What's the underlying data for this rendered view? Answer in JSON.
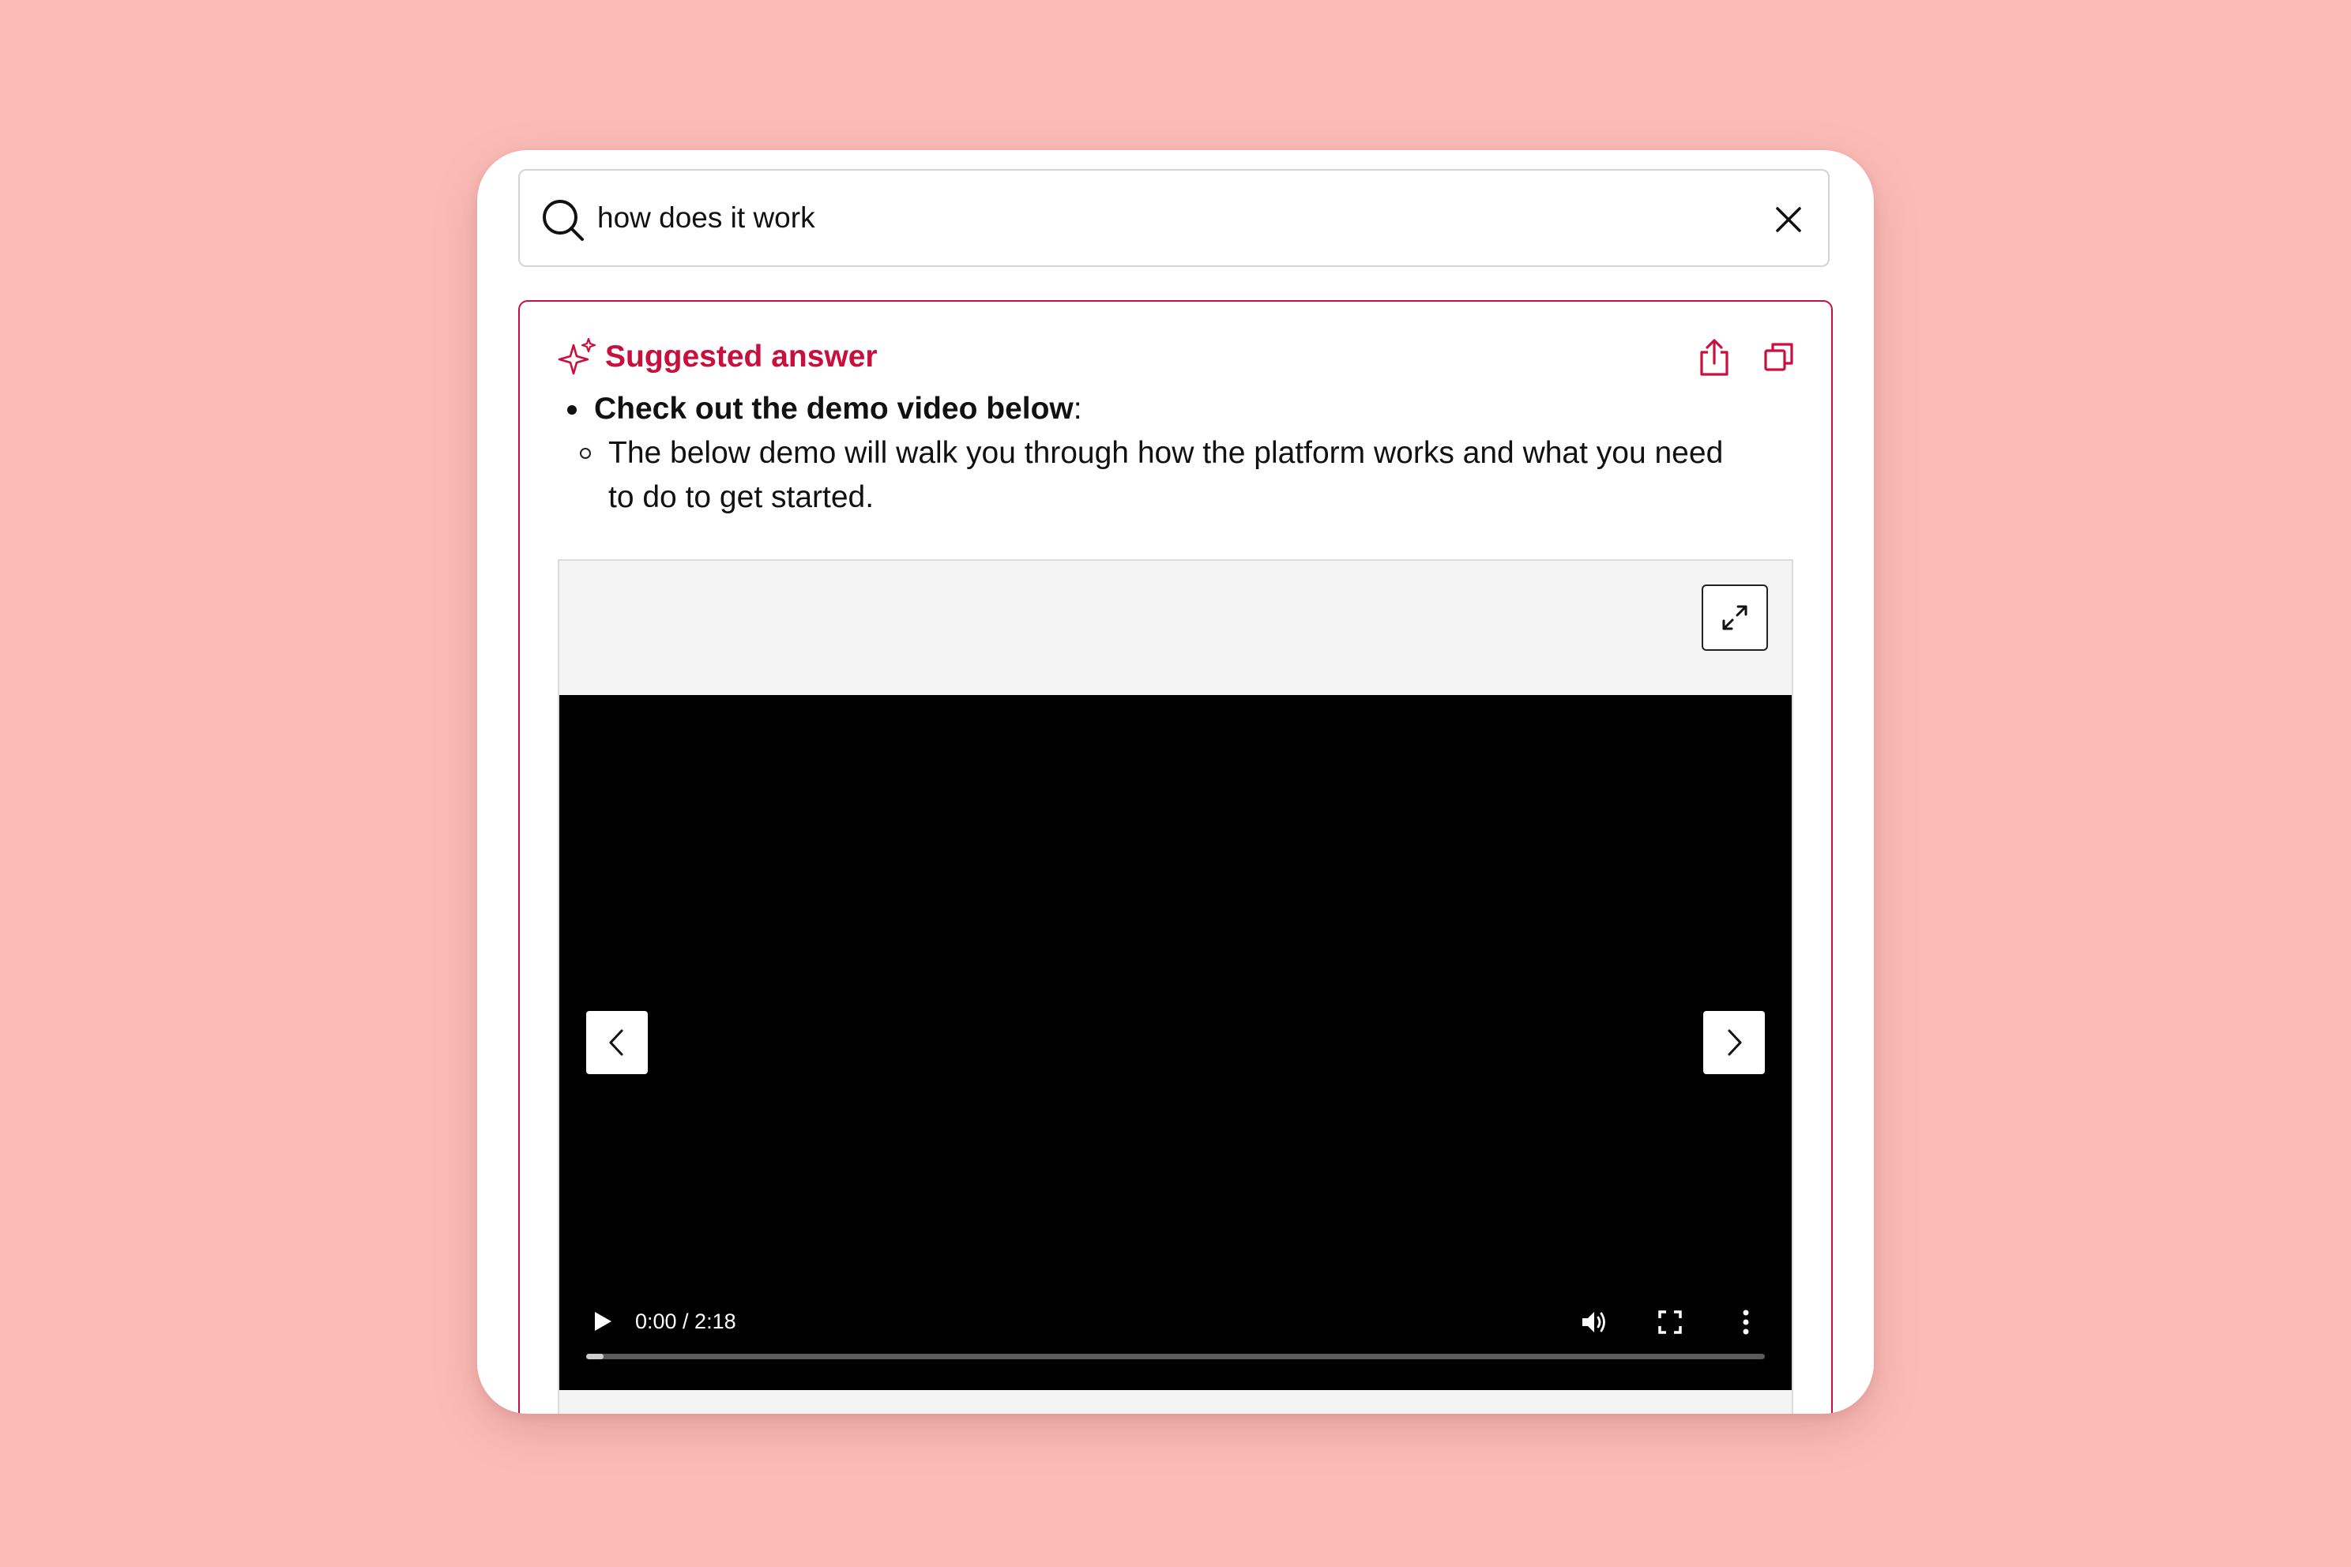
{
  "search": {
    "query": "how does it work"
  },
  "answer": {
    "title": "Suggested answer",
    "bullet_bold": "Check out the demo video below",
    "bullet_suffix": ":",
    "sub_bullet": "The below demo will walk you through how the platform works and what you need to do to get started."
  },
  "video": {
    "time": "0:00 / 2:18",
    "progress": 0.015
  },
  "colors": {
    "background": "#fbbcb8",
    "accent": "#c8103e",
    "video_bg": "#000000"
  },
  "icons": {
    "search": "search-icon",
    "clear": "close-icon",
    "sparkle": "sparkle-icon",
    "share": "share-icon",
    "copy": "copy-icon",
    "expand": "expand-icon",
    "prev": "chevron-left-icon",
    "next": "chevron-right-icon",
    "play": "play-icon",
    "volume": "volume-icon",
    "fullscreen": "fullscreen-icon",
    "more": "more-vertical-icon"
  }
}
